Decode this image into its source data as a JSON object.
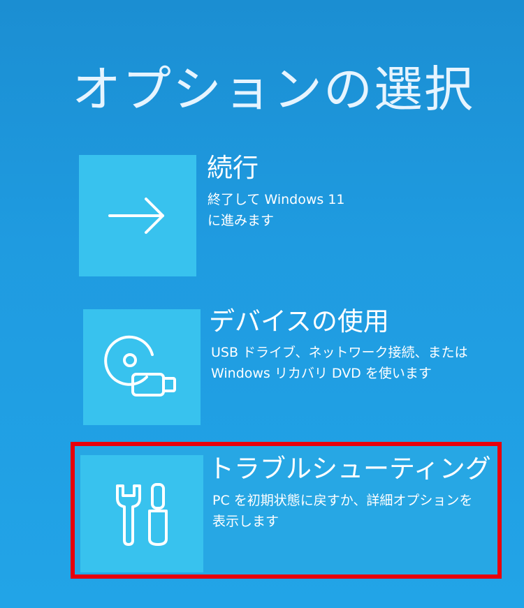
{
  "page": {
    "title": "オプションの選択"
  },
  "options": [
    {
      "title": "続行",
      "description": [
        "終了して Windows 11",
        "に進みます"
      ],
      "icon": "arrow-right-icon"
    },
    {
      "title": "デバイスの使用",
      "description": [
        "USB ドライブ、ネットワーク接続、または",
        "Windows リカバリ DVD を使います"
      ],
      "icon": "disc-usb-icon"
    },
    {
      "title": "トラブルシューティング",
      "description": [
        "PC を初期状態に戻すか、詳細オプションを",
        "表示します"
      ],
      "icon": "tools-icon"
    }
  ],
  "colors": {
    "background": "#1f9be0",
    "tile": "#38c2ee",
    "highlight": "#e8000b"
  }
}
